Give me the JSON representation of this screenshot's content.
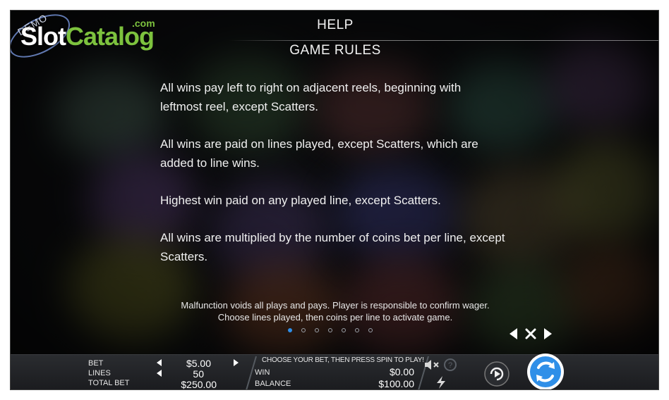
{
  "watermark": {
    "demo": "DEMO",
    "brand_a": "Slot",
    "brand_b": "Catalog",
    "tld": ".com"
  },
  "header": {
    "help": "HELP",
    "section": "GAME RULES"
  },
  "rules": [
    "All wins pay left to right on adjacent reels, beginning with leftmost reel, except Scatters.",
    "All wins are paid on lines played, except Scatters, which are added to line wins.",
    "Highest win paid on any played line, except Scatters.",
    "All wins are multiplied by the number of coins bet per line, except Scatters."
  ],
  "footer_note": "Malfunction voids all plays and pays. Player is responsible to confirm wager. Choose lines played, then coins per line to activate game.",
  "pagination": {
    "total": 7,
    "active": 1
  },
  "nav_icons": {
    "prev": "triangle-left-icon",
    "close": "close-icon",
    "next": "triangle-right-icon"
  },
  "bottom_bar": {
    "bet_label": "BET",
    "bet_value": "$5.00",
    "lines_label": "LINES",
    "lines_value": "50",
    "total_bet_label": "TOTAL BET",
    "total_bet_value": "$250.00",
    "prompt": "CHOOSE YOUR BET, THEN PRESS SPIN TO PLAY!",
    "win_label": "WIN",
    "win_value": "$0.00",
    "balance_label": "BALANCE",
    "balance_value": "$100.00"
  },
  "colors": {
    "accent_blue": "#2f8fe8",
    "brand_green": "#7dc23e",
    "text": "#f0f0f0",
    "bar_bg": "#1f2024"
  }
}
